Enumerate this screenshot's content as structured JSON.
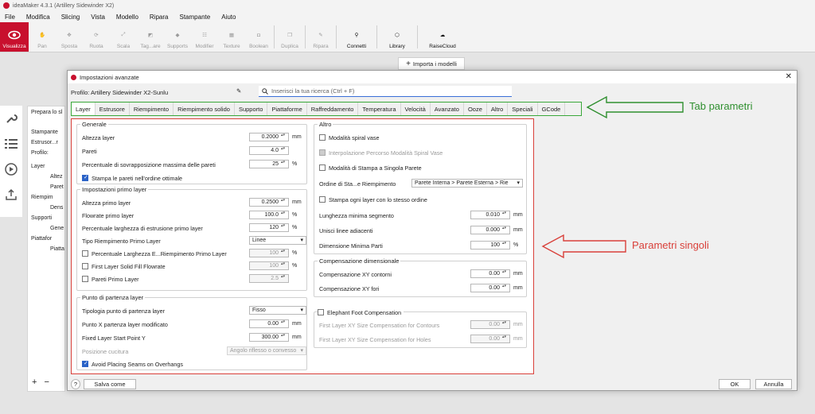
{
  "window": {
    "title": "ideaMaker 4.3.1 (Artillery Sidewinder X2)"
  },
  "menu": [
    "File",
    "Modifica",
    "Slicing",
    "Vista",
    "Modello",
    "Ripara",
    "Stampante",
    "Aiuto"
  ],
  "toolbar": {
    "items": [
      {
        "label": "Visualizza",
        "icon": "eye-icon"
      },
      {
        "label": "Pan",
        "icon": "hand-icon"
      },
      {
        "label": "Sposta",
        "icon": "move-icon"
      },
      {
        "label": "Ruota",
        "icon": "rotate-icon"
      },
      {
        "label": "Scala",
        "icon": "scale-icon"
      },
      {
        "label": "Tag...are",
        "icon": "cut-icon"
      },
      {
        "label": "Supports",
        "icon": "supports-icon"
      },
      {
        "label": "Modifier",
        "icon": "modifier-icon"
      },
      {
        "label": "Texture",
        "icon": "texture-icon"
      },
      {
        "label": "Boolean",
        "icon": "boolean-icon"
      },
      {
        "label": "Duplica",
        "icon": "duplicate-icon"
      },
      {
        "label": "Ripara",
        "icon": "repair-icon"
      }
    ],
    "right_items": [
      {
        "label": "Connetti",
        "icon": "connect-icon"
      },
      {
        "label": "Library",
        "icon": "library-icon"
      },
      {
        "label": "RaiseCloud",
        "icon": "cloud-icon"
      }
    ],
    "import_label": "Importa i modelli"
  },
  "left_panel": {
    "items": [
      "Prepara lo sl",
      "Stampante",
      "Estrusor...r",
      "Profilo:",
      "Layer",
      "Altez",
      "Paret",
      "Riempim",
      "Dens",
      "Supporti",
      "Gene",
      "Piattafor",
      "Piatta"
    ]
  },
  "dialog": {
    "title": "Impostazioni avanzate",
    "profile_label": "Profilo: Artillery Sidewinder X2-Sunlu",
    "search_placeholder": "Inserisci la tua ricerca (Ctrl + F)",
    "tabs": [
      "Layer",
      "Estrusore",
      "Riempimento",
      "Riempimento solido",
      "Supporto",
      "Piattaforme",
      "Raffreddamento",
      "Temperatura",
      "Velocità",
      "Avanzato",
      "Ooze",
      "Altro",
      "Speciali",
      "GCode"
    ],
    "generale": {
      "title": "Generale",
      "altezza_layer": {
        "label": "Altezza layer",
        "value": "0.2000",
        "unit": "mm"
      },
      "pareti": {
        "label": "Pareti",
        "value": "4.0"
      },
      "sovrapposizione": {
        "label": "Percentuale di sovrapposizione massima delle pareti",
        "value": "25",
        "unit": "%"
      },
      "stampa_pareti": {
        "label": "Stampa le pareti nell'ordine ottimale"
      }
    },
    "primo_layer": {
      "title": "Impostazioni primo layer",
      "altezza": {
        "label": "Altezza primo layer",
        "value": "0.2500",
        "unit": "mm"
      },
      "flowrate": {
        "label": "Flowrate primo layer",
        "value": "100.0",
        "unit": "%"
      },
      "larghezza": {
        "label": "Percentuale larghezza di estrusione primo layer",
        "value": "120",
        "unit": "%"
      },
      "tipo": {
        "label": "Tipo Riempimento Primo Layer",
        "value": "Linee"
      },
      "perc_riemp": {
        "label": "Percentuale Larghezza E...Riempimento Primo Layer",
        "value": "100",
        "unit": "%"
      },
      "solid_fill": {
        "label": "First Layer Solid Fill Flowrate",
        "value": "100",
        "unit": "%"
      },
      "pareti_primo": {
        "label": "Pareti Primo Layer",
        "value": "2.5"
      }
    },
    "punto_partenza": {
      "title": "Punto di partenza layer",
      "tipologia": {
        "label": "Tipologia punto di partenza layer",
        "value": "Fisso"
      },
      "punto_x": {
        "label": "Punto X partenza layer modificato",
        "value": "0.00",
        "unit": "mm"
      },
      "punto_y": {
        "label": "Fixed Layer Start Point Y",
        "value": "300.00",
        "unit": "mm"
      },
      "cucitura": {
        "label": "Posizione cucitura",
        "value": "Angolo riflesso o convesso"
      },
      "avoid": {
        "label": "Avoid Placing Seams on Overhangs"
      }
    },
    "altro": {
      "title": "Altro",
      "spiral": {
        "label": "Modalità spiral vase"
      },
      "interp": {
        "label": "Interpolazione Percorso Modalità Spiral Vase"
      },
      "singola": {
        "label": "Modalità di Stampa a Singola Parete"
      },
      "ordine": {
        "label": "Ordine di Sta...e Riempimento",
        "value": "Parete Interna > Parete Esterna > Rie"
      },
      "stesso_ordine": {
        "label": "Stampa ogni layer con lo stesso ordine"
      },
      "lunghezza": {
        "label": "Lunghezza minima segmento",
        "value": "0.010",
        "unit": "mm"
      },
      "unisci": {
        "label": "Unisci linee adiacenti",
        "value": "0.000",
        "unit": "mm"
      },
      "dimensione": {
        "label": "Dimensione Minima Parti",
        "value": "100",
        "unit": "%"
      }
    },
    "compensazione": {
      "title": "Compensazione dimensionale",
      "contorni": {
        "label": "Compensazione XY contorni",
        "value": "0.00",
        "unit": "mm"
      },
      "fori": {
        "label": "Compensazione XY fori",
        "value": "0.00",
        "unit": "mm"
      }
    },
    "elephant": {
      "title": "Elephant Foot Compensation",
      "contours": {
        "label": "First Layer XY Size Compensation for Contours",
        "value": "0.00",
        "unit": "mm"
      },
      "holes": {
        "label": "First Layer XY Size Compensation for Holes",
        "value": "0.00",
        "unit": "mm"
      }
    },
    "buttons": {
      "help": "?",
      "save_as": "Salva come",
      "ok": "OK",
      "cancel": "Annulla"
    }
  },
  "annotations": {
    "tabs_label": "Tab parametri",
    "params_label": "Parametri singoli",
    "green": "#2f8f2f",
    "red": "#d9403a"
  }
}
